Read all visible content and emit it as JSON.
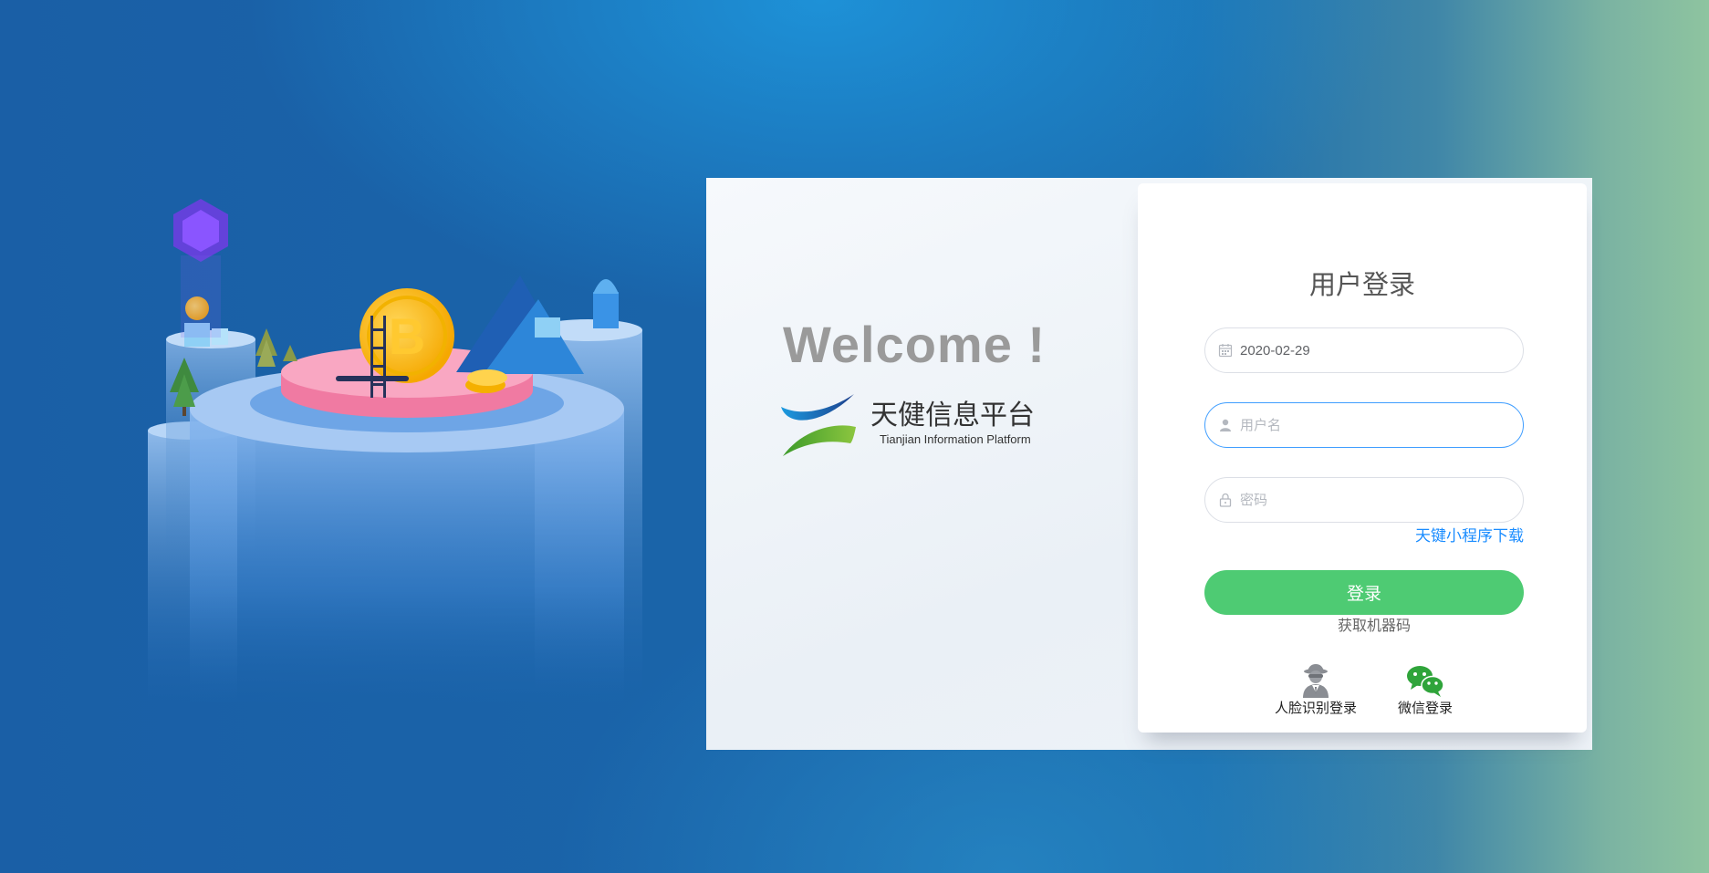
{
  "welcome": {
    "title": "Welcome !",
    "brand_cn": "天健信息平台",
    "brand_en": "Tianjian Information Platform"
  },
  "login": {
    "title": "用户登录",
    "date_value": "2020-02-29",
    "username_placeholder": "用户名",
    "password_placeholder": "密码",
    "mini_program_link": "天键小程序下载",
    "submit_label": "登录",
    "machine_code_link": "获取机器码",
    "alt_methods": [
      {
        "label": "人脸识别登录",
        "icon": "spy-face-icon"
      },
      {
        "label": "微信登录",
        "icon": "wechat-icon"
      }
    ]
  },
  "colors": {
    "primary_button": "#4ecb73",
    "link": "#1a8cff",
    "focus_border": "#409eff"
  }
}
